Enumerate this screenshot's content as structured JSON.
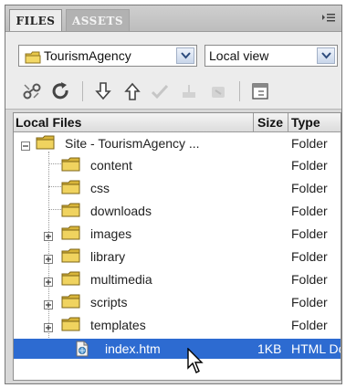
{
  "tabs": [
    {
      "label": "FILES",
      "active": true
    },
    {
      "label": "ASSETS",
      "active": false
    }
  ],
  "site_select": {
    "value": "TourismAgency",
    "icon": "folder-icon"
  },
  "view_select": {
    "value": "Local view"
  },
  "toolbar": {
    "buttons": [
      "connect-icon",
      "refresh-icon",
      "get-files-icon",
      "put-files-icon",
      "check-out-icon",
      "check-in-icon",
      "synchronize-icon",
      "expand-icon"
    ]
  },
  "columns": {
    "name": "Local Files",
    "size": "Size",
    "type": "Type"
  },
  "files": [
    {
      "name": "Site - TourismAgency ...",
      "size": "",
      "type": "Folder",
      "kind": "root"
    },
    {
      "name": "content",
      "size": "",
      "type": "Folder",
      "kind": "folder"
    },
    {
      "name": "css",
      "size": "",
      "type": "Folder",
      "kind": "folder"
    },
    {
      "name": "downloads",
      "size": "",
      "type": "Folder",
      "kind": "folder"
    },
    {
      "name": "images",
      "size": "",
      "type": "Folder",
      "kind": "folder-expandable"
    },
    {
      "name": "library",
      "size": "",
      "type": "Folder",
      "kind": "folder-expandable"
    },
    {
      "name": "multimedia",
      "size": "",
      "type": "Folder",
      "kind": "folder-expandable"
    },
    {
      "name": "scripts",
      "size": "",
      "type": "Folder",
      "kind": "folder-expandable"
    },
    {
      "name": "templates",
      "size": "",
      "type": "Folder",
      "kind": "folder-expandable"
    },
    {
      "name": "index.htm",
      "size": "1KB",
      "type": "HTML Do",
      "kind": "file",
      "selected": true
    }
  ],
  "colors": {
    "selection": "#2d6bd1",
    "folder": "#e9c84a"
  }
}
